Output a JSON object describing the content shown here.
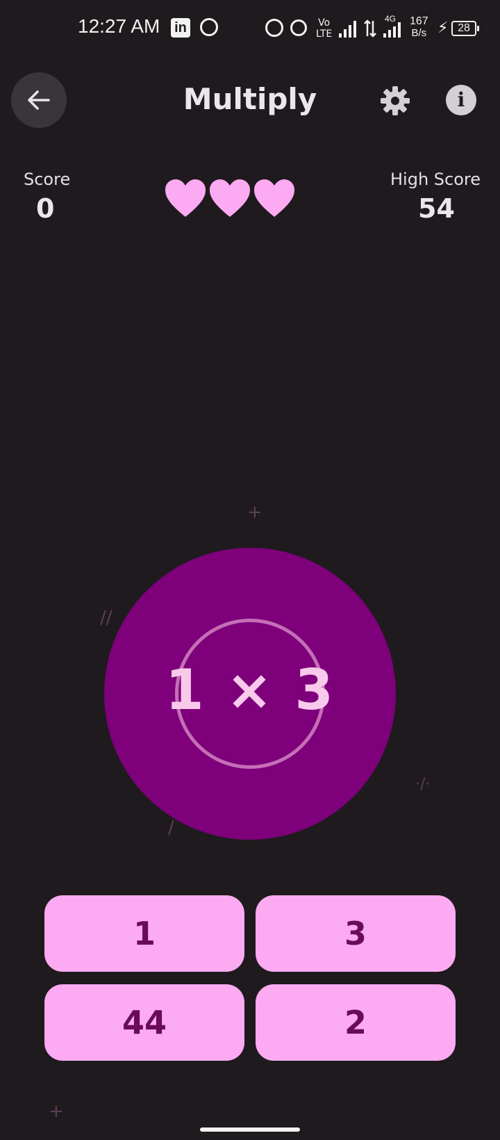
{
  "status_bar": {
    "time": "12:27 AM",
    "network_vo": "Vo",
    "network_lte": "LTE",
    "network_4g": "4G",
    "speed_value": "167",
    "speed_unit": "B/s",
    "battery": "28",
    "linkedin_glyph": "in"
  },
  "app_bar": {
    "title": "Multiply",
    "back_icon": "arrow-left-icon",
    "settings_icon": "gear-icon",
    "info_icon": "info-icon",
    "info_glyph": "i"
  },
  "scoreboard": {
    "score_label": "Score",
    "score_value": "0",
    "high_score_label": "High Score",
    "high_score_value": "54",
    "lives": 3,
    "heart_color": "#fcaaf1"
  },
  "question": {
    "text": "1 × 3"
  },
  "answers": [
    "1",
    "3",
    "44",
    "2"
  ],
  "colors": {
    "background": "#1f1a1e",
    "circle": "#7e007b",
    "ring": "#c56fb6",
    "answer_bg": "#fcaaf1",
    "answer_text": "#6a0a5a"
  }
}
